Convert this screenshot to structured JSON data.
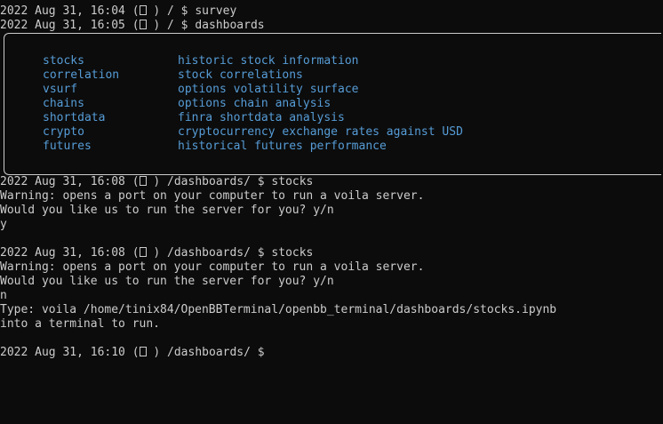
{
  "terminal": {
    "lines_top": [
      {
        "pre": "2022 Aug 31, 16:04 (",
        "post": " ) / $ survey"
      },
      {
        "pre": "2022 Aug 31, 16:05 (",
        "post": " ) / $ dashboards"
      }
    ],
    "menu": [
      {
        "cmd": "stocks",
        "desc": "historic stock information"
      },
      {
        "cmd": "correlation",
        "desc": "stock correlations"
      },
      {
        "cmd": "vsurf",
        "desc": "options volatility surface"
      },
      {
        "cmd": "chains",
        "desc": "options chain analysis"
      },
      {
        "cmd": "shortdata",
        "desc": "finra shortdata analysis"
      },
      {
        "cmd": "crypto",
        "desc": "cryptocurrency exchange rates against USD"
      },
      {
        "cmd": "futures",
        "desc": "historical futures performance"
      }
    ],
    "block1": {
      "prompt_pre": "2022 Aug 31, 16:08 (",
      "prompt_post": " ) /dashboards/ $ stocks",
      "warning": "Warning: opens a port on your computer to run a voila server.",
      "question": "Would you like us to run the server for you? y/n",
      "answer": "y"
    },
    "block2": {
      "prompt_pre": "2022 Aug 31, 16:08 (",
      "prompt_post": " ) /dashboards/ $ stocks",
      "warning": "Warning: opens a port on your computer to run a voila server.",
      "question": "Would you like us to run the server for you? y/n",
      "answer": "n",
      "type_line": "Type: voila /home/tinix84/OpenBBTerminal/openbb_terminal/dashboards/stocks.ipynb",
      "into_line": "into a terminal to run."
    },
    "final_prompt": {
      "pre": "2022 Aug 31, 16:10 (",
      "post": " ) /dashboards/ $"
    }
  }
}
